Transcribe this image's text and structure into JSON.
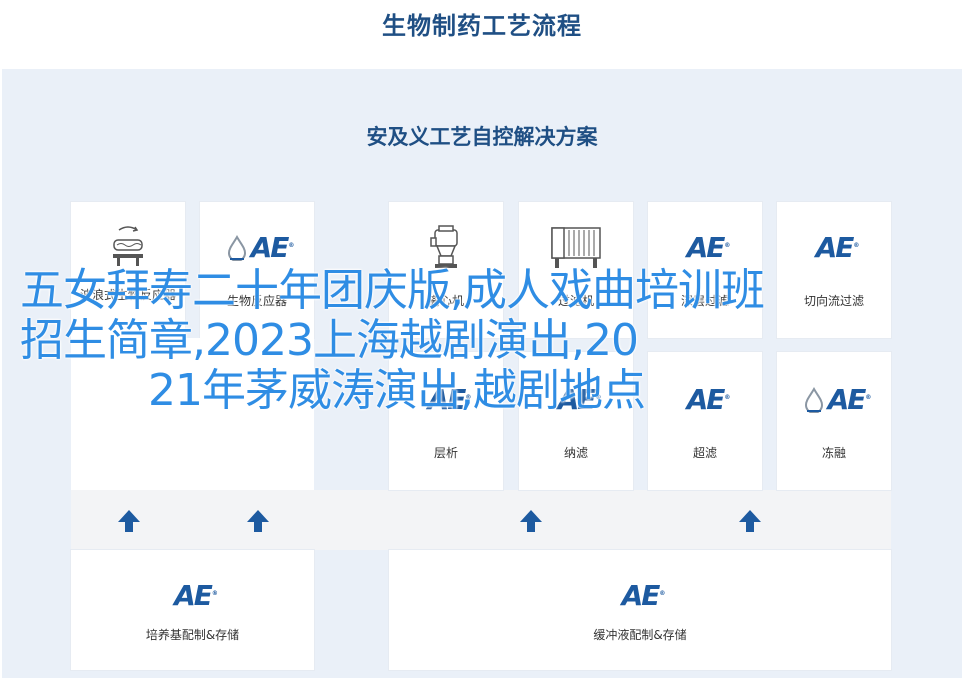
{
  "page_title": "生物制药工艺流程",
  "panel_title": "安及义工艺自控解决方案",
  "logo_text": "AE",
  "logo_mark": "®",
  "colors": {
    "brand_blue": "#1d5aa0",
    "title_blue": "#1f4f84",
    "overlay_blue": "#2f8de4",
    "panel_bg": "#eaf0f8"
  },
  "top_cards": [
    {
      "label": "波浪式生物反应器",
      "icon": "wave-bioreactor-icon"
    },
    {
      "label": "生物反应器",
      "icon": "ae-logo"
    },
    {
      "label": "离心机",
      "icon": "centrifuge-icon"
    },
    {
      "label": "过滤机",
      "icon": "filter-press-icon"
    },
    {
      "label": "深层过滤",
      "icon": "ae-logo"
    },
    {
      "label": "切向流过滤",
      "icon": "ae-logo"
    }
  ],
  "middle_cards": [
    {
      "label": "层析"
    },
    {
      "label": "纳滤"
    },
    {
      "label": "超滤"
    },
    {
      "label": "冻融"
    }
  ],
  "bottom_cards": [
    {
      "label": "培养基配制&存储"
    },
    {
      "label": "缓冲液配制&存储"
    }
  ],
  "overlay": {
    "line1": "五女拜寿二十年团庆版,成人戏曲培训班",
    "line2": "招生简章,2023上海越剧演出,20",
    "line3": "21年茅威涛演出,越剧地点"
  }
}
